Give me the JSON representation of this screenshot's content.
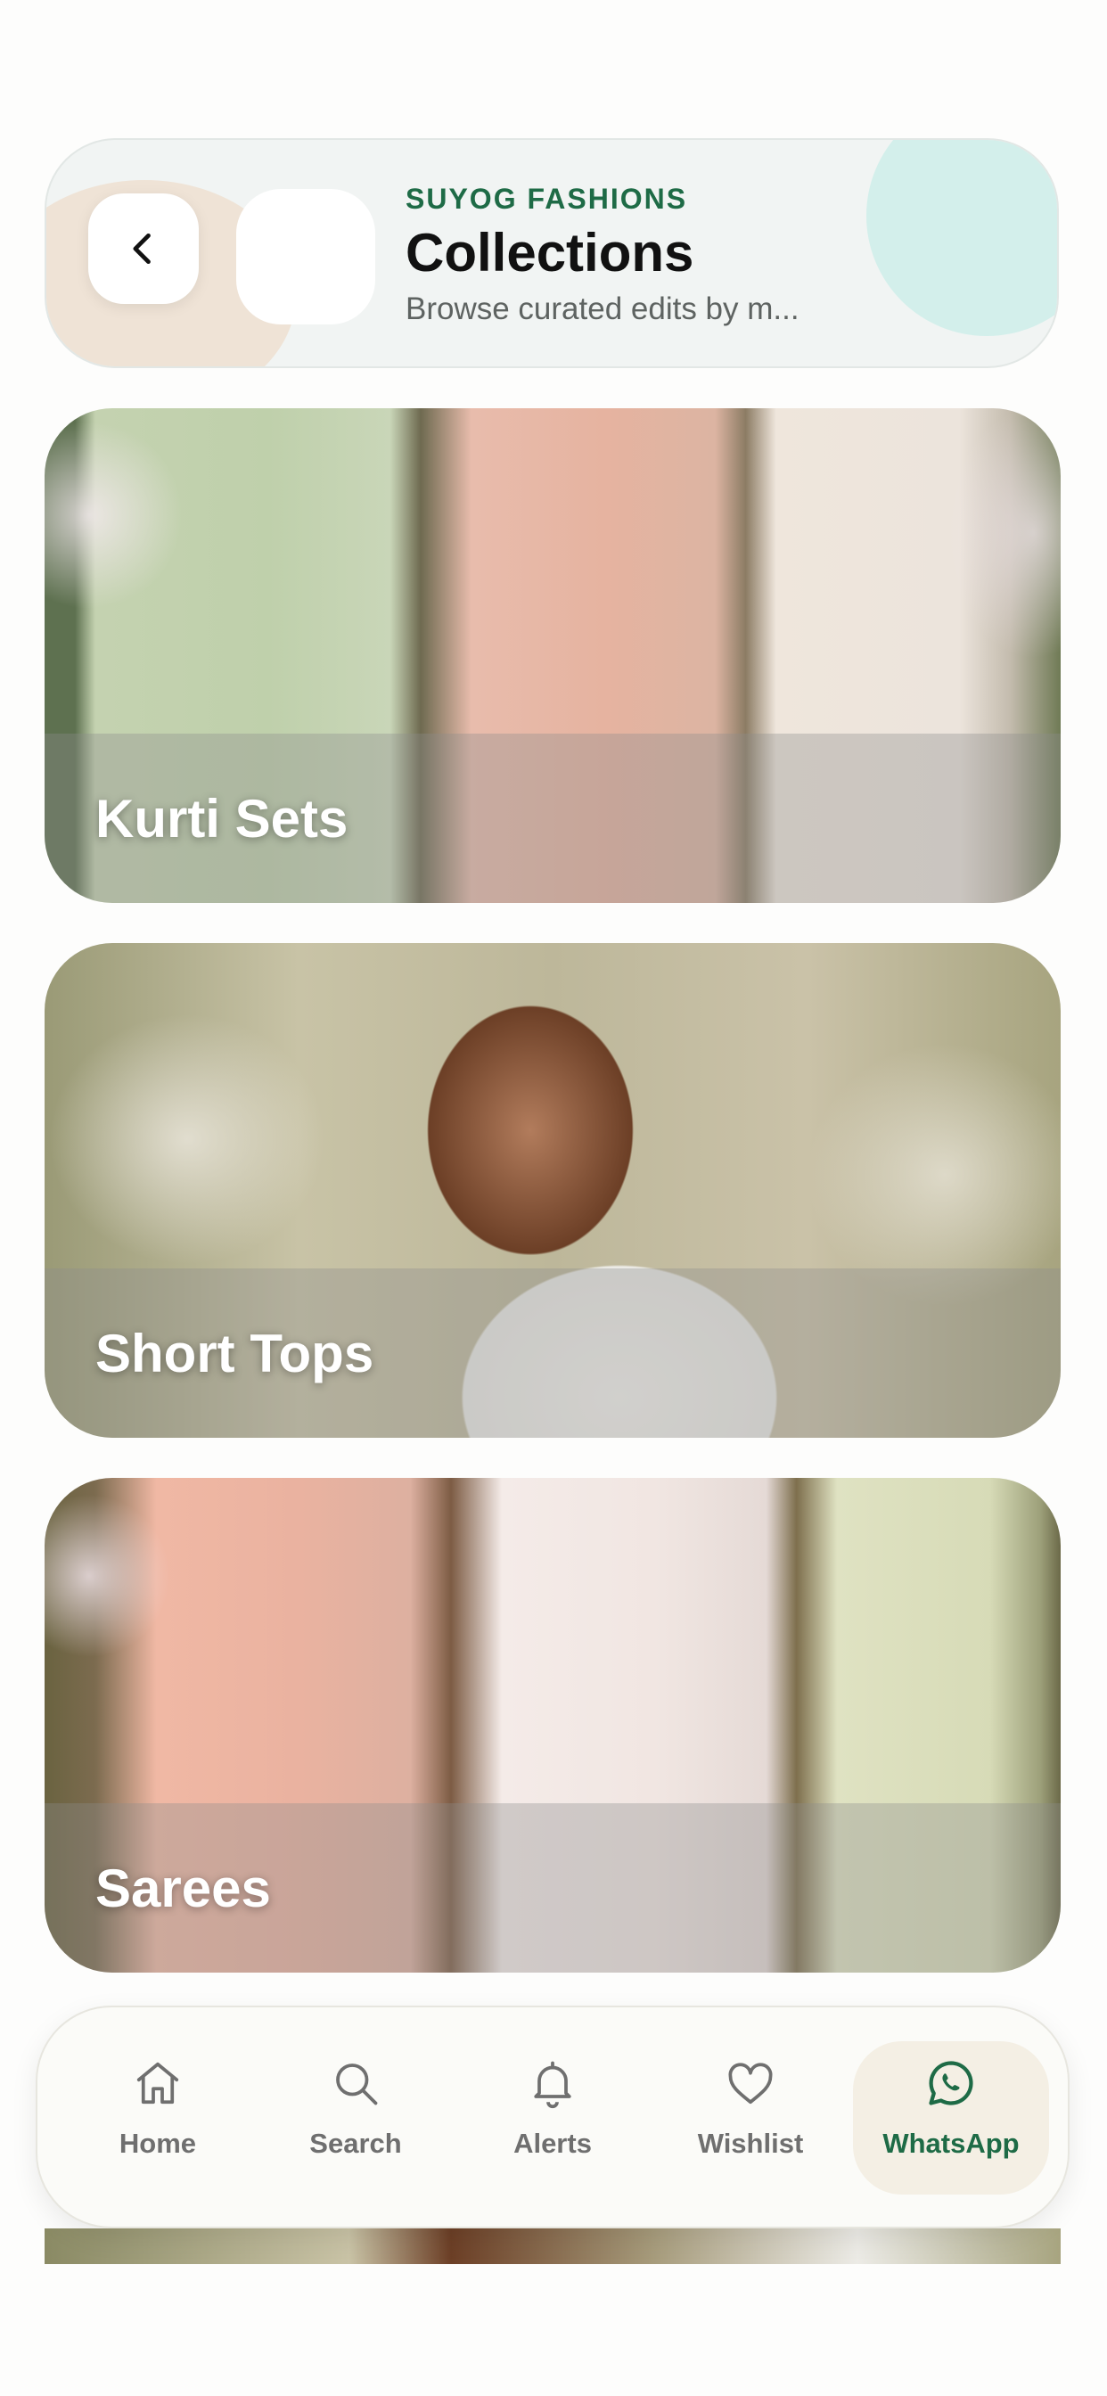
{
  "header": {
    "brand": "SUYOG FASHIONS",
    "title": "Collections",
    "subtitle": "Browse curated edits by m..."
  },
  "collections": [
    {
      "label": "Kurti Sets"
    },
    {
      "label": "Short Tops"
    },
    {
      "label": "Sarees"
    }
  ],
  "bottom_nav": {
    "items": [
      {
        "label": "Home",
        "icon": "home-icon"
      },
      {
        "label": "Search",
        "icon": "search-icon"
      },
      {
        "label": "Alerts",
        "icon": "bell-icon"
      },
      {
        "label": "Wishlist",
        "icon": "heart-icon"
      },
      {
        "label": "WhatsApp",
        "icon": "whatsapp-icon",
        "active": true
      }
    ]
  },
  "colors": {
    "brand_green": "#1e6b46",
    "active_tab_bg": "#f4efe4",
    "nav_text": "#6f6f6f"
  }
}
